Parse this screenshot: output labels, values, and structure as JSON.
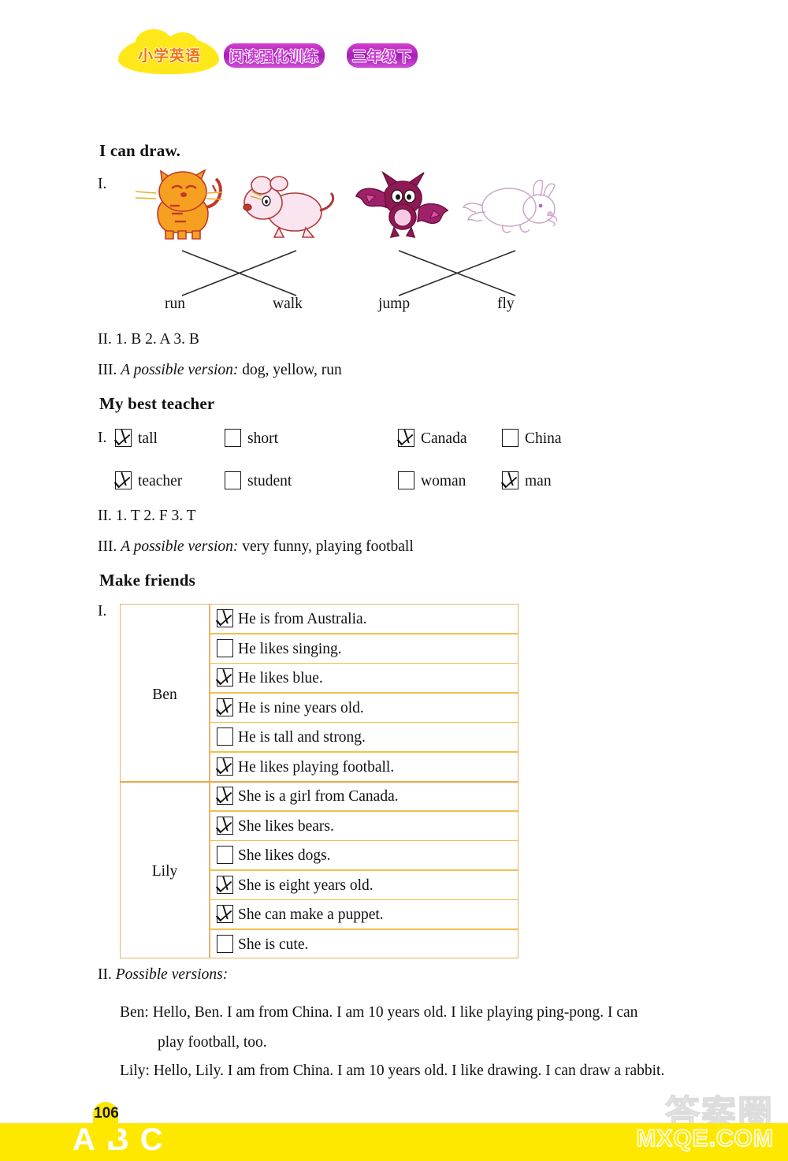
{
  "header": {
    "badge_text": "小学英语",
    "magenta_text_1": "阅读强化训练",
    "magenta_text_2": "三年级下"
  },
  "sections": [
    {
      "title": "I can draw.",
      "exercise1_label": "I.",
      "animals": [
        "cat",
        "mouse",
        "bat",
        "rabbit"
      ],
      "words": [
        "run",
        "walk",
        "jump",
        "fly"
      ],
      "answer2": "II. 1. B   2. A   3. B",
      "answer3_label": "III.",
      "answer3_italic": "A possible version:",
      "answer3_text": "dog, yellow, run"
    },
    {
      "title": "My best teacher",
      "exercise1_label": "I.",
      "checkbox_options": [
        {
          "label": "tall",
          "checked": true
        },
        {
          "label": "short",
          "checked": false
        },
        {
          "label": "Canada",
          "checked": true
        },
        {
          "label": "China",
          "checked": false
        },
        {
          "label": "teacher",
          "checked": true
        },
        {
          "label": "student",
          "checked": false
        },
        {
          "label": "woman",
          "checked": false
        },
        {
          "label": "man",
          "checked": true
        }
      ],
      "answer2": "II. 1. T   2. F   3. T",
      "answer3_label": "III.",
      "answer3_italic": "A possible version:",
      "answer3_text": "very funny,  playing football"
    },
    {
      "title": "Make friends",
      "exercise1_label": "I.",
      "table": {
        "groups": [
          {
            "name": "Ben",
            "statements": [
              {
                "text": "He is from Australia.",
                "checked": true
              },
              {
                "text": "He likes singing.",
                "checked": false
              },
              {
                "text": "He likes blue.",
                "checked": true
              },
              {
                "text": "He is nine years old.",
                "checked": true
              },
              {
                "text": "He is tall and strong.",
                "checked": false
              },
              {
                "text": "He likes playing football.",
                "checked": true
              }
            ]
          },
          {
            "name": "Lily",
            "statements": [
              {
                "text": "She is a girl from Canada.",
                "checked": true
              },
              {
                "text": "She likes bears.",
                "checked": true
              },
              {
                "text": "She likes dogs.",
                "checked": false
              },
              {
                "text": "She is eight years old.",
                "checked": true
              },
              {
                "text": "She can make a puppet.",
                "checked": true
              },
              {
                "text": "She is cute.",
                "checked": false
              }
            ]
          }
        ]
      },
      "answer2_label": "II.",
      "answer2_italic": "Possible versions:",
      "paragraphs": [
        "Ben: Hello, Ben. I am from China. I am 10 years old. I like playing ping-pong. I can",
        "play football, too.",
        "Lily: Hello, Lily. I am from China. I am 10 years old. I like drawing. I can draw a rabbit."
      ]
    }
  ],
  "footer": {
    "page_number": "106",
    "abc_mark": "ABC",
    "watermark_cn": "答案圈",
    "watermark_site": "MXQE.COM"
  },
  "colors": {
    "badge_yellow": "#ffe81a",
    "badge_text_orange": "#f4720c",
    "magenta": "#c936d6",
    "table_border": "#e8b36a",
    "row_line": "#f0c04e",
    "footer_yellow": "#ffe800"
  }
}
